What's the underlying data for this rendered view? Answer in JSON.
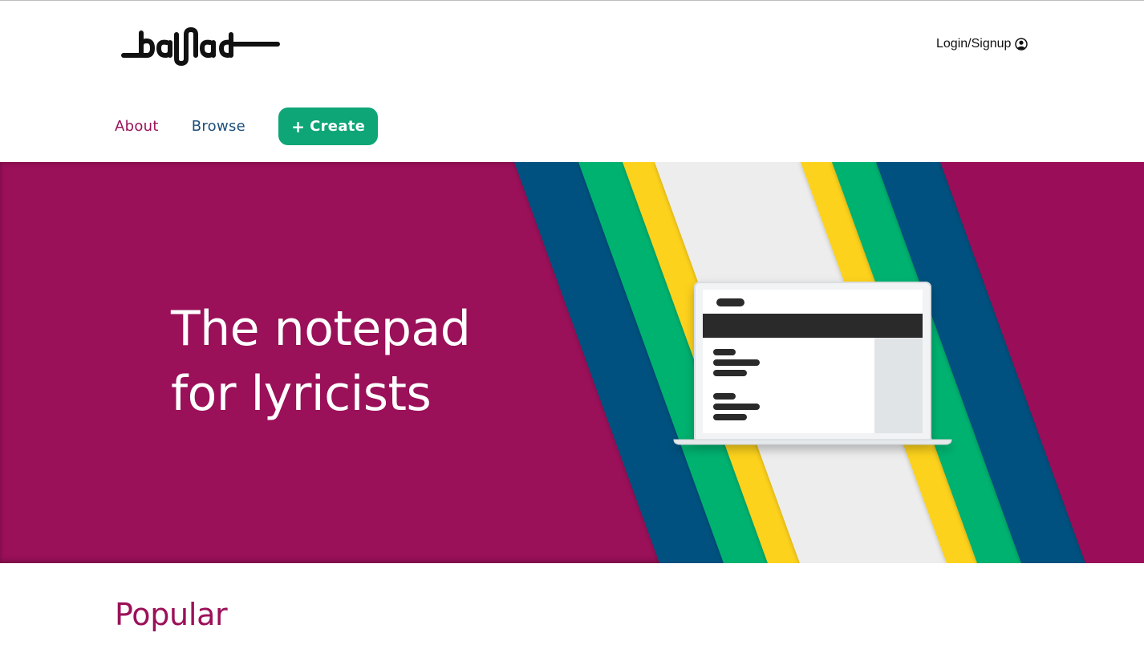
{
  "header": {
    "logo_text": "ballad",
    "login_label": "Login/Signup",
    "login_icon": "user-circle-icon"
  },
  "nav": {
    "about": "About",
    "browse": "Browse",
    "create": "Create",
    "create_icon": "plus-icon"
  },
  "hero": {
    "title_line1": "The notepad",
    "title_line2": "for lyricists"
  },
  "popular": {
    "heading": "Popular"
  },
  "colors": {
    "brand_magenta": "#9a1059",
    "blue": "#00517f",
    "green": "#00b26f",
    "yellow": "#fdd21d",
    "light_gray": "#ededed",
    "create_green": "#0ea577",
    "nav_blue": "#1e4f7a"
  }
}
